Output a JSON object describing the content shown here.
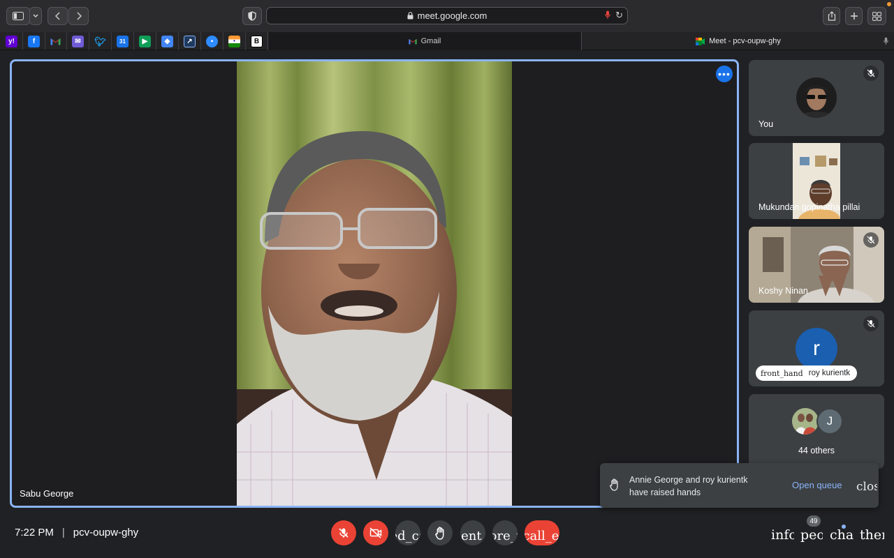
{
  "browser": {
    "url": "meet.google.com",
    "bookmarks": [
      "yahoo-icon",
      "facebook-icon",
      "gmail-icon",
      "mail-icon",
      "twitter-icon",
      "calendar-icon",
      "meet-icon",
      "maps-icon",
      "chart-icon",
      "zoom-icon",
      "flag-india-icon",
      "b-icon"
    ],
    "bookmark_b_letter": "B",
    "tabs": [
      {
        "label": "Gmail",
        "icon": "gmail-icon"
      },
      {
        "label": "Meet - pcv-oupw-ghy",
        "icon": "meet-icon"
      }
    ]
  },
  "meeting": {
    "code": "pcv-oupw-ghy",
    "time": "7:22 PM",
    "separator": "|",
    "main_speaker": "Sabu George",
    "tile_more_icon": "•••",
    "participants": [
      {
        "name": "You",
        "muted": true
      },
      {
        "name": "Mukundan gopinatha pillai",
        "muted": false
      },
      {
        "name": "Koshy Ninan",
        "muted": true
      },
      {
        "name": "roy kurientk",
        "initial": "r",
        "muted": true,
        "hand_ligature": "front_hand"
      }
    ],
    "others": {
      "label": "44 others",
      "initial": "J"
    }
  },
  "toast": {
    "text": "Annie George and roy kurientk have raised hands",
    "action": "Open queue",
    "close": "close"
  },
  "controls": {
    "captions": "closed_caption",
    "present": "present_to_all",
    "more": "more_vert",
    "call_end": "call_end",
    "info": "info",
    "people": "people",
    "people_count": "49",
    "chat": "chat",
    "activities": "therapy"
  },
  "colors": {
    "accent": "#8ab4f8",
    "danger": "#ea4335",
    "primary": "#1a73e8",
    "surface": "#3c4043",
    "background": "#202124"
  }
}
